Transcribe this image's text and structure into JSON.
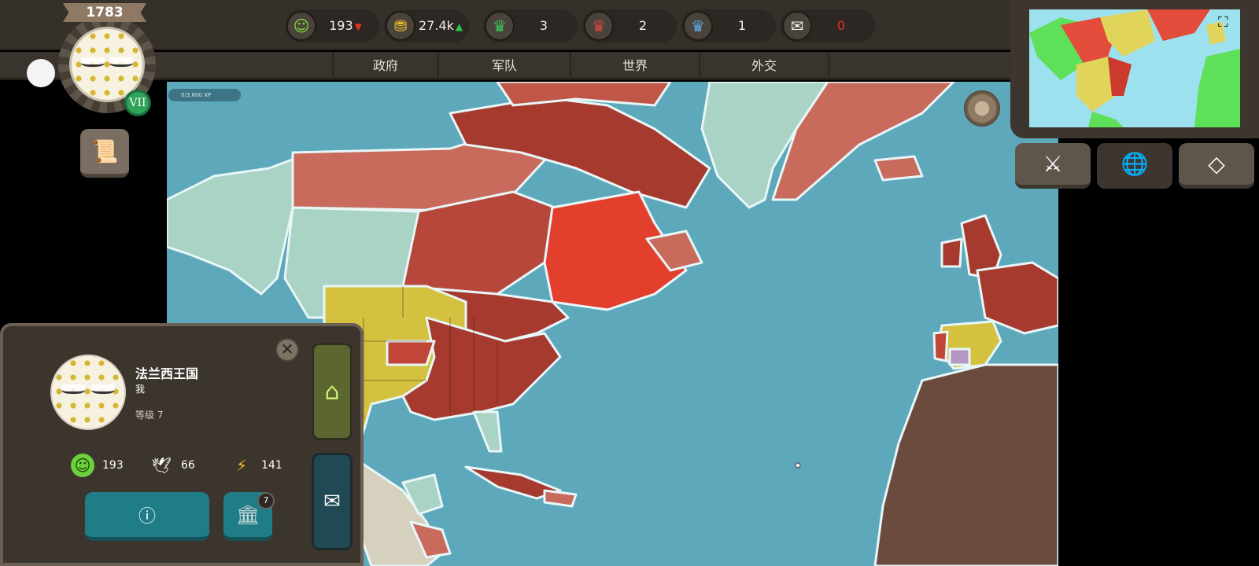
{
  "year": "1783",
  "level_roman": "VII",
  "xp": "0/3,600 XP",
  "stats": [
    {
      "icon": "happiness-icon",
      "value": "193",
      "trend": "down",
      "trend_color": "#e0322a"
    },
    {
      "icon": "gold-coins-icon",
      "value": "27.4k",
      "trend": "up",
      "trend_color": "#29c84a"
    },
    {
      "icon": "green-crown-icon",
      "value": "3"
    },
    {
      "icon": "red-crown-icon",
      "value": "2"
    },
    {
      "icon": "blue-crown-icon",
      "value": "1"
    },
    {
      "icon": "letter-icon",
      "value": "0",
      "value_color": "#e0322a"
    }
  ],
  "tabs": [
    "政府",
    "军队",
    "世界",
    "外交"
  ],
  "nation": {
    "name": "法兰西王国",
    "subtitle": "我",
    "level": "等级 7",
    "happiness": "193",
    "military": "66",
    "energy": "141",
    "bank_badge": "7"
  },
  "right_buttons": [
    "sword-icon",
    "globe-icon",
    "diamond-icon"
  ],
  "colors": {
    "ocean": "#5da8bb",
    "france": "#a63a2e",
    "england": "#cf6457",
    "independent": "#e23f2d",
    "spain": "#d4c13f",
    "neutral": "#a9d3c5",
    "africa": "#6a4b3e"
  }
}
